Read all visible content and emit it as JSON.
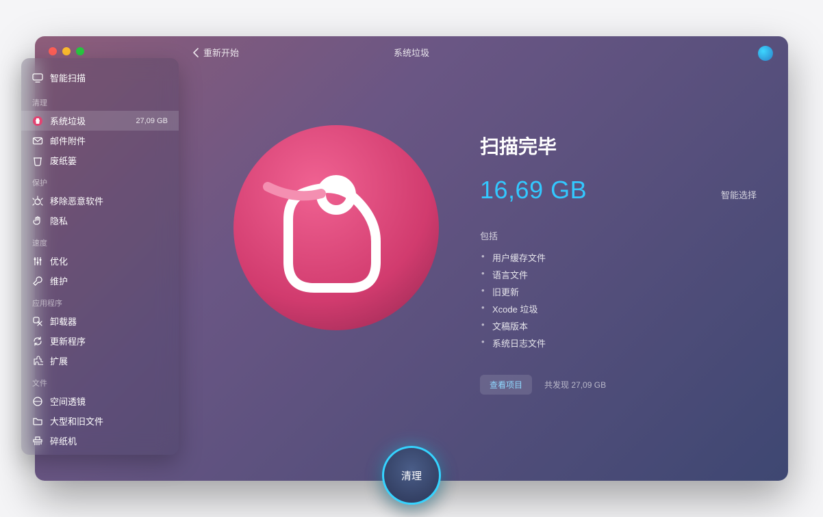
{
  "topbar": {
    "back_label": "重新开始",
    "title": "系统垃圾"
  },
  "sidebar": {
    "smart_scan": "智能扫描",
    "sections": [
      {
        "title": "清理",
        "items": [
          {
            "label": "系统垃圾",
            "badge": "27,09 GB",
            "active": true,
            "icon": "trash-badge"
          },
          {
            "label": "邮件附件",
            "icon": "envelope"
          },
          {
            "label": "废纸篓",
            "icon": "bin"
          }
        ]
      },
      {
        "title": "保护",
        "items": [
          {
            "label": "移除恶意软件",
            "icon": "bug"
          },
          {
            "label": "隐私",
            "icon": "hand"
          }
        ]
      },
      {
        "title": "速度",
        "items": [
          {
            "label": "优化",
            "icon": "sliders"
          },
          {
            "label": "维护",
            "icon": "wrench"
          }
        ]
      },
      {
        "title": "应用程序",
        "items": [
          {
            "label": "卸载器",
            "icon": "uninstall"
          },
          {
            "label": "更新程序",
            "icon": "update"
          },
          {
            "label": "扩展",
            "icon": "extension"
          }
        ]
      },
      {
        "title": "文件",
        "items": [
          {
            "label": "空间透镜",
            "icon": "lens"
          },
          {
            "label": "大型和旧文件",
            "icon": "folder"
          },
          {
            "label": "碎纸机",
            "icon": "shredder"
          }
        ]
      }
    ]
  },
  "main": {
    "heading": "扫描完毕",
    "size": "16,69 GB",
    "smart_select": "智能选择",
    "includes_label": "包括",
    "includes": [
      "用户缓存文件",
      "语言文件",
      "旧更新",
      "Xcode 垃圾",
      "文稿版本",
      "系统日志文件"
    ],
    "view_items": "查看项目",
    "found_prefix": "共发现",
    "found_size": "27,09 GB"
  },
  "clean_button": "清理"
}
